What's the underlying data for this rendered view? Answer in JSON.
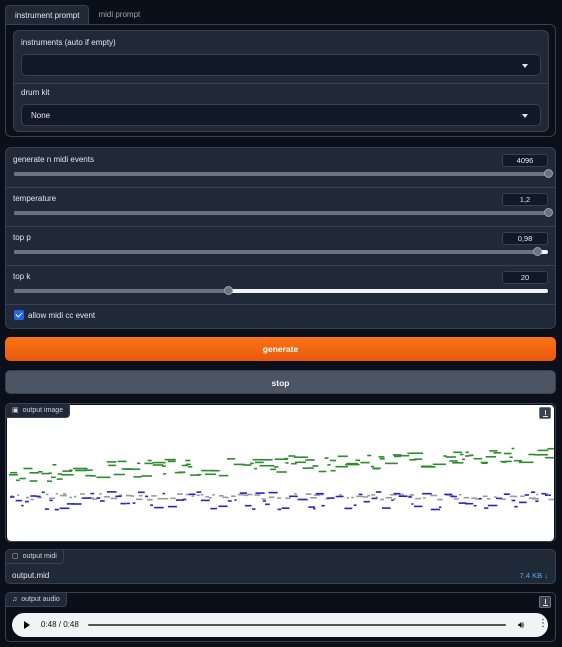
{
  "tabs": [
    {
      "label": "instrument prompt",
      "active": true
    },
    {
      "label": "midi prompt",
      "active": false
    }
  ],
  "instrument_prompt": {
    "instruments": {
      "label": "instruments (auto if empty)",
      "value": ""
    },
    "drum_kit": {
      "label": "drum kit",
      "value": "None"
    }
  },
  "sliders": [
    {
      "label": "generate n midi events",
      "value": "4096",
      "fraction": 1.0
    },
    {
      "label": "temperature",
      "value": "1,2",
      "fraction": 1.0
    },
    {
      "label": "top p",
      "value": "0,98",
      "fraction": 0.98
    },
    {
      "label": "top k",
      "value": "20",
      "fraction": 0.4
    }
  ],
  "allow_cc": {
    "label": "allow midi cc event",
    "checked": true
  },
  "buttons": {
    "generate": "generate",
    "stop": "stop"
  },
  "output_image": {
    "label": "output image",
    "icon": "image-icon"
  },
  "output_midi": {
    "label": "output midi",
    "icon": "file-icon",
    "filename": "output.mid",
    "size": "7.4 KB ↓"
  },
  "output_audio": {
    "label": "output audio",
    "icon": "music-icon",
    "time": "0:48 / 0:48",
    "progress": 1.0
  },
  "colors": {
    "accent": "#f97316",
    "checkbox": "#2563eb",
    "piano_green": "#2e8b2e",
    "piano_blue": "#2424c8",
    "piano_gray": "#9a9a9a"
  }
}
